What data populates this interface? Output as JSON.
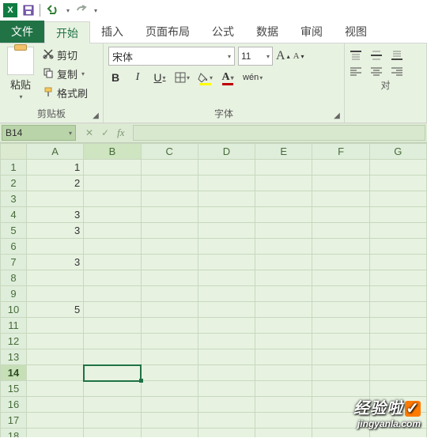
{
  "qat": {
    "app_icon": "excel-icon",
    "save_icon": "save-icon",
    "undo_icon": "undo-icon",
    "redo_icon": "redo-icon"
  },
  "tabs": {
    "file": "文件",
    "home": "开始",
    "insert": "插入",
    "page_layout": "页面布局",
    "formulas": "公式",
    "data": "数据",
    "review": "审阅",
    "view": "视图"
  },
  "ribbon": {
    "clipboard": {
      "paste": "粘贴",
      "cut": "剪切",
      "copy": "复制",
      "format_painter": "格式刷",
      "group_label": "剪贴板"
    },
    "font": {
      "name": "宋体",
      "size": "11",
      "bold": "B",
      "italic": "I",
      "underline": "U",
      "ruby": "wén",
      "group_label": "字体",
      "font_color": "#c00000",
      "fill_color": "#ffff00"
    },
    "alignment": {
      "group_label_partial": "对"
    }
  },
  "namebox": "B14",
  "columns": [
    "A",
    "B",
    "C",
    "D",
    "E",
    "F",
    "G"
  ],
  "rows": [
    {
      "n": 1,
      "A": "1"
    },
    {
      "n": 2,
      "A": "2"
    },
    {
      "n": 3
    },
    {
      "n": 4,
      "A": "3"
    },
    {
      "n": 5,
      "A": "3"
    },
    {
      "n": 6
    },
    {
      "n": 7,
      "A": "3"
    },
    {
      "n": 8
    },
    {
      "n": 9
    },
    {
      "n": 10,
      "A": "5"
    },
    {
      "n": 11
    },
    {
      "n": 12
    },
    {
      "n": 13
    },
    {
      "n": 14
    },
    {
      "n": 15
    },
    {
      "n": 16
    },
    {
      "n": 17
    },
    {
      "n": 18
    }
  ],
  "selected": {
    "row": 14,
    "col": "B"
  },
  "watermark": {
    "line1": "经验啦",
    "check": "✓",
    "line2": "jingyanla.com"
  }
}
